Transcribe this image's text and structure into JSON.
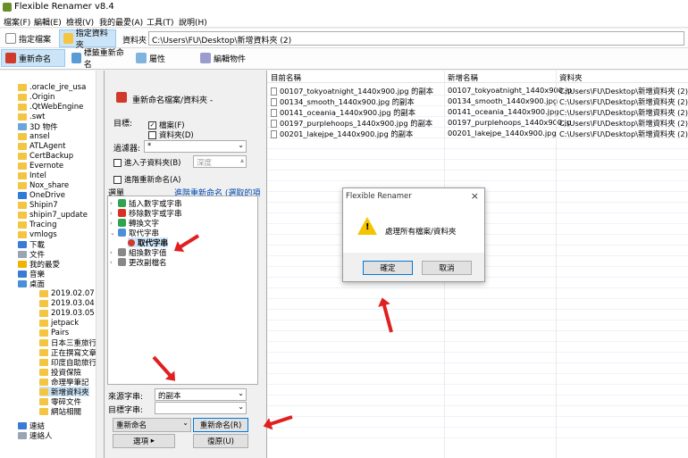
{
  "window": {
    "title": "Flexible Renamer v8.4"
  },
  "menu": [
    "檔案(F)",
    "編輯(E)",
    "檢視(V)",
    "我的最愛(A)",
    "工具(T)",
    "說明(H)"
  ],
  "toolbar1": {
    "tab_file": "指定檔案",
    "tab_folder": "指定資料夾",
    "path_label": "資料夾",
    "path_value": "C:\\Users\\FU\\Desktop\\新增資料夾 (2)"
  },
  "toolbar2": {
    "rename": "重新命名",
    "tag_rename": "標籤重新命名",
    "properties": "屬性",
    "edit_object": "編輯物件"
  },
  "tree": [
    ".oracle_jre_usa",
    ".Origin",
    ".QtWebEngine",
    ".swt",
    "3D 物件",
    "ansel",
    "ATLAgent",
    "CertBackup",
    "Evernote",
    "Intel",
    "Nox_share",
    "OneDrive",
    "Shipin7",
    "shipin7_update",
    "Tracing",
    "vmlogs",
    "下載",
    "文件",
    "我的最愛",
    "音樂",
    "桌面",
    "2019.02.07",
    "2019.03.04",
    "2019.03.05",
    "jetpack",
    "Pairs",
    "日本三重旅行",
    "正在撰寫文章",
    "印度自助旅行",
    "投資保險",
    "命理學筆記",
    "新增資料夾",
    "零碎文件",
    "網站相關",
    "連結",
    "連絡人"
  ],
  "panel": {
    "header": "重新命名檔案/資料夾 -",
    "target_label": "目標:",
    "cb_files": "檔案(F)",
    "cb_folders": "資料夾(D)",
    "filter_label": "過濾器:",
    "filter_value": "*",
    "subfolder": "進入子資料夾(B)",
    "depth": "深度",
    "advanced": "進階重新命名(A)",
    "menu_label": "選單",
    "advanced_link": "進階重新命名 (選取的項目)",
    "ops": [
      "插入數字或字串",
      "移除數字或字串",
      "轉換文字",
      "取代字串",
      "取代字串",
      "組換數字值",
      "更改副檔名"
    ],
    "source_label": "來源字串:",
    "source_value": "的副本",
    "target_str_label": "目標字串:",
    "target_str_value": "",
    "rename_combo": "重新命名",
    "rename_button": "重新命名(R)",
    "options_button": "選項",
    "undo_button": "復原(U)"
  },
  "table": {
    "headers": [
      "目前名稱",
      "新增名稱",
      "資料夾"
    ],
    "rows": [
      [
        "00107_tokyoatnight_1440x900.jpg 的副本",
        "00107_tokyoatnight_1440x900.jp",
        "C:\\Users\\FU\\Desktop\\新增資料夾 (2)"
      ],
      [
        "00134_smooth_1440x900.jpg 的副本",
        "00134_smooth_1440x900.jpg",
        "C:\\Users\\FU\\Desktop\\新增資料夾 (2)"
      ],
      [
        "00141_oceania_1440x900.jpg 的副本",
        "00141_oceania_1440x900.jpg",
        "C:\\Users\\FU\\Desktop\\新增資料夾 (2)"
      ],
      [
        "00197_purplehoops_1440x900.jpg 的副本",
        "00197_purplehoops_1440x900.jp",
        "C:\\Users\\FU\\Desktop\\新增資料夾 (2)"
      ],
      [
        "00201_lakejpe_1440x900.jpg 的副本",
        "00201_lakejpe_1440x900.jpg",
        "C:\\Users\\FU\\Desktop\\新增資料夾 (2)"
      ]
    ]
  },
  "dialog": {
    "title": "Flexible Renamer",
    "close": "×",
    "message": "處理所有檔案/資料夾",
    "ok": "確定",
    "cancel": "取消"
  },
  "colors": {
    "accent": "#cce4f7",
    "arrow": "#e02020",
    "folder": "#f4c542"
  }
}
